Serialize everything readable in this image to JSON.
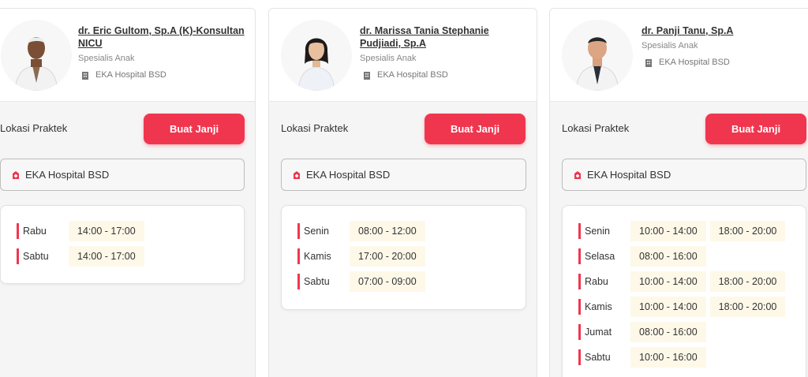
{
  "cards": [
    {
      "name": "dr. Eric Gultom, Sp.A (K)-Konsultan NICU",
      "specialty": "Spesialis Anak",
      "hospital": "EKA Hospital BSD",
      "location_label": "Lokasi Praktek",
      "button_label": "Buat Janji",
      "selected_hospital": "EKA Hospital BSD",
      "schedule": [
        {
          "day": "Rabu",
          "times": [
            "14:00 - 17:00"
          ]
        },
        {
          "day": "Sabtu",
          "times": [
            "14:00 - 17:00"
          ]
        }
      ]
    },
    {
      "name": "dr. Marissa Tania Stephanie Pudjiadi, Sp.A",
      "specialty": "Spesialis Anak",
      "hospital": "EKA Hospital BSD",
      "location_label": "Lokasi Praktek",
      "button_label": "Buat Janji",
      "selected_hospital": "EKA Hospital BSD",
      "schedule": [
        {
          "day": "Senin",
          "times": [
            "08:00 - 12:00"
          ]
        },
        {
          "day": "Kamis",
          "times": [
            "17:00 - 20:00"
          ]
        },
        {
          "day": "Sabtu",
          "times": [
            "07:00 - 09:00"
          ]
        }
      ]
    },
    {
      "name": "dr. Panji Tanu, Sp.A",
      "specialty": "Spesialis Anak",
      "hospital": "EKA Hospital BSD",
      "location_label": "Lokasi Praktek",
      "button_label": "Buat Janji",
      "selected_hospital": "EKA Hospital BSD",
      "schedule": [
        {
          "day": "Senin",
          "times": [
            "10:00 - 14:00",
            "18:00 - 20:00"
          ]
        },
        {
          "day": "Selasa",
          "times": [
            "08:00 - 16:00"
          ]
        },
        {
          "day": "Rabu",
          "times": [
            "10:00 - 14:00",
            "18:00 - 20:00"
          ]
        },
        {
          "day": "Kamis",
          "times": [
            "10:00 - 14:00",
            "18:00 - 20:00"
          ]
        },
        {
          "day": "Jumat",
          "times": [
            "08:00 - 16:00"
          ]
        },
        {
          "day": "Sabtu",
          "times": [
            "10:00 - 16:00"
          ]
        }
      ]
    }
  ],
  "colors": {
    "accent": "#f0364f",
    "slot_bg": "#fdf8e8"
  },
  "icons": {
    "hospital": "building-icon",
    "pin": "hospital-pin-icon"
  }
}
